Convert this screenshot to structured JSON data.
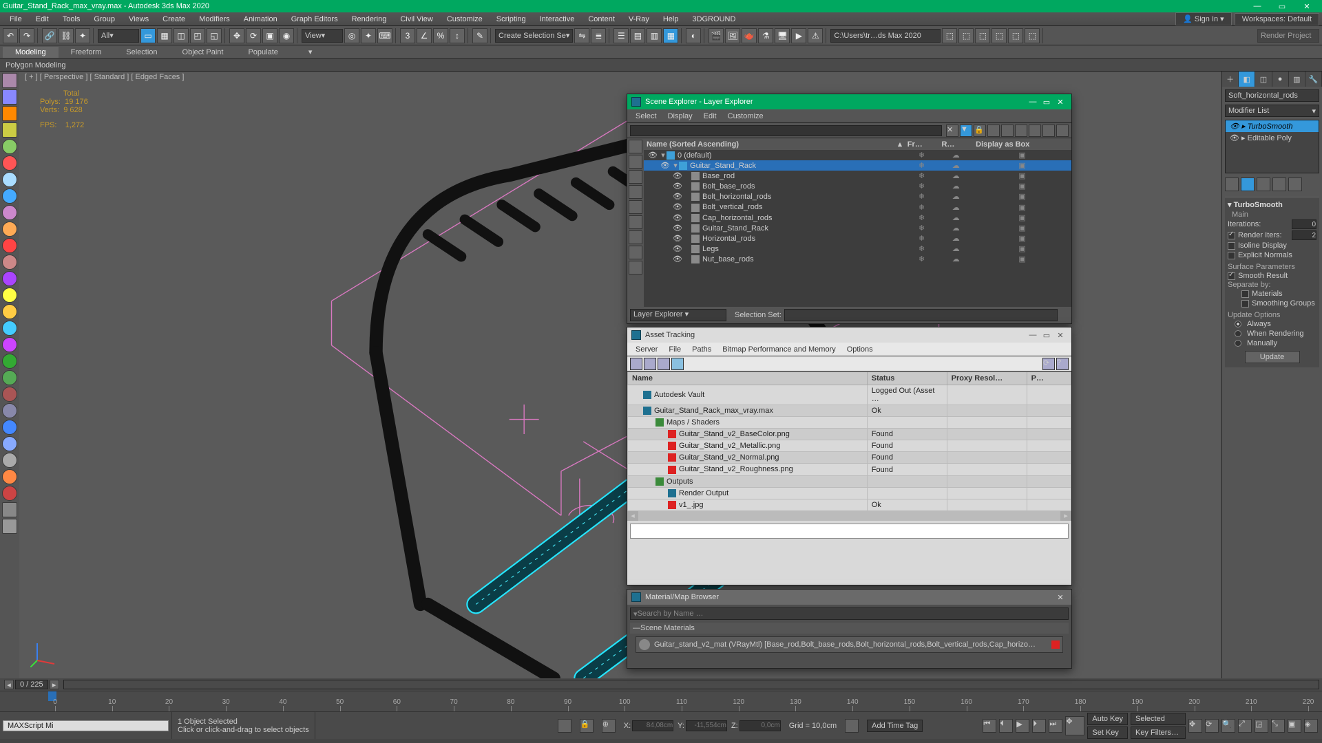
{
  "title": "Guitar_Stand_Rack_max_vray.max - Autodesk 3ds Max 2020",
  "menubar": [
    "File",
    "Edit",
    "Tools",
    "Group",
    "Views",
    "Create",
    "Modifiers",
    "Animation",
    "Graph Editors",
    "Rendering",
    "Civil View",
    "Customize",
    "Scripting",
    "Interactive",
    "Content",
    "V-Ray",
    "Help",
    "3DGROUND"
  ],
  "signin": "Sign In",
  "workspace_label": "Workspaces:",
  "workspace_value": "Default",
  "toolbar_dropdowns": {
    "all": "All",
    "view": "View",
    "create_sel": "Create Selection Se"
  },
  "render_path": "C:\\Users\\tr…ds Max 2020",
  "render_project_btn": "Render Project",
  "ribbon": [
    "Modeling",
    "Freeform",
    "Selection",
    "Object Paint",
    "Populate"
  ],
  "ribbon_selected": 0,
  "polystrip": "Polygon Modeling",
  "viewport_head": "[ + ] [ Perspective ] [ Standard ] [ Edged Faces ]",
  "viewport_stats": {
    "total": "Total",
    "polys_lbl": "Polys:",
    "polys": "19 176",
    "verts_lbl": "Verts:",
    "verts": "9 628",
    "fps_lbl": "FPS:",
    "fps": "1,272"
  },
  "cmd": {
    "obj_name": "Soft_horizontal_rods",
    "mod_list_label": "Modifier List",
    "stack": [
      "TurboSmooth",
      "Editable Poly"
    ],
    "rollup": "TurboSmooth",
    "main_lbl": "Main",
    "iterations_lbl": "Iterations:",
    "iterations": "0",
    "render_iters_lbl": "Render Iters:",
    "render_iters": "2",
    "isoline": "Isoline Display",
    "explicit": "Explicit Normals",
    "surf_params": "Surface Parameters",
    "smooth": "Smooth Result",
    "separate": "Separate by:",
    "materials": "Materials",
    "sgroups": "Smoothing Groups",
    "update_opts": "Update Options",
    "always": "Always",
    "when_render": "When Rendering",
    "manually": "Manually",
    "update_btn": "Update"
  },
  "scene_explorer": {
    "title": "Scene Explorer - Layer Explorer",
    "menu": [
      "Select",
      "Display",
      "Edit",
      "Customize"
    ],
    "cols": [
      "Name (Sorted Ascending)",
      "Fr…",
      "R…",
      "Display as Box"
    ],
    "rows": [
      {
        "name": "0 (default)",
        "depth": 0,
        "type": "layer",
        "open": true
      },
      {
        "name": "Guitar_Stand_Rack",
        "depth": 1,
        "type": "layer",
        "open": true,
        "sel": true
      },
      {
        "name": "Base_rod",
        "depth": 2,
        "type": "geom"
      },
      {
        "name": "Bolt_base_rods",
        "depth": 2,
        "type": "geom"
      },
      {
        "name": "Bolt_horizontal_rods",
        "depth": 2,
        "type": "geom"
      },
      {
        "name": "Bolt_vertical_rods",
        "depth": 2,
        "type": "geom"
      },
      {
        "name": "Cap_horizontal_rods",
        "depth": 2,
        "type": "geom"
      },
      {
        "name": "Guitar_Stand_Rack",
        "depth": 2,
        "type": "geom"
      },
      {
        "name": "Horizontal_rods",
        "depth": 2,
        "type": "geom"
      },
      {
        "name": "Legs",
        "depth": 2,
        "type": "geom"
      },
      {
        "name": "Nut_base_rods",
        "depth": 2,
        "type": "geom"
      }
    ],
    "footer": {
      "label": "Layer Explorer",
      "sel_set": "Selection Set:"
    }
  },
  "asset_tracking": {
    "title": "Asset Tracking",
    "menu": [
      "Server",
      "File",
      "Paths",
      "Bitmap Performance and Memory",
      "Options"
    ],
    "cols": [
      "Name",
      "Status",
      "Proxy Resol…",
      "P…"
    ],
    "rows": [
      {
        "name": "Autodesk Vault",
        "status": "Logged Out (Asset …",
        "ind": 1,
        "ico": "b"
      },
      {
        "name": "Guitar_Stand_Rack_max_vray.max",
        "status": "Ok",
        "ind": 1,
        "ico": "b",
        "stripe": true
      },
      {
        "name": "Maps / Shaders",
        "status": "",
        "ind": 2,
        "ico": "g"
      },
      {
        "name": "Guitar_Stand_v2_BaseColor.png",
        "status": "Found",
        "ind": 3,
        "ico": "r",
        "stripe": true
      },
      {
        "name": "Guitar_Stand_v2_Metallic.png",
        "status": "Found",
        "ind": 3,
        "ico": "r"
      },
      {
        "name": "Guitar_Stand_v2_Normal.png",
        "status": "Found",
        "ind": 3,
        "ico": "r",
        "stripe": true
      },
      {
        "name": "Guitar_Stand_v2_Roughness.png",
        "status": "Found",
        "ind": 3,
        "ico": "r"
      },
      {
        "name": "Outputs",
        "status": "",
        "ind": 2,
        "ico": "g",
        "stripe": true
      },
      {
        "name": "Render Output",
        "status": "",
        "ind": 3,
        "ico": "b"
      },
      {
        "name": "v1_.jpg",
        "status": "Ok",
        "ind": 3,
        "ico": "r"
      }
    ]
  },
  "mat_browser": {
    "title": "Material/Map Browser",
    "search_placeholder": "Search by Name …",
    "section": "Scene Materials",
    "item": "Guitar_stand_v2_mat (VRayMtl) [Base_rod,Bolt_base_rods,Bolt_horizontal_rods,Bolt_vertical_rods,Cap_horizo…"
  },
  "timeline": {
    "frame": "0 / 225",
    "marks": [
      0,
      10,
      20,
      30,
      40,
      50,
      60,
      70,
      80,
      90,
      100,
      110,
      120,
      130,
      140,
      150,
      160,
      170,
      180,
      190,
      200,
      210,
      220
    ]
  },
  "status": {
    "sel": "1 Object Selected",
    "hint": "Click or click-and-drag to select objects",
    "script": "MAXScript Mi",
    "x_lbl": "X:",
    "x": "84,08cm",
    "y_lbl": "Y:",
    "y": "-11,554cm",
    "z_lbl": "Z:",
    "z": "0,0cm",
    "grid": "Grid = 10,0cm",
    "addtag": "Add Time Tag",
    "autokey": "Auto Key",
    "setkey": "Set Key",
    "selected": "Selected",
    "keyfilters": "Key Filters…"
  }
}
